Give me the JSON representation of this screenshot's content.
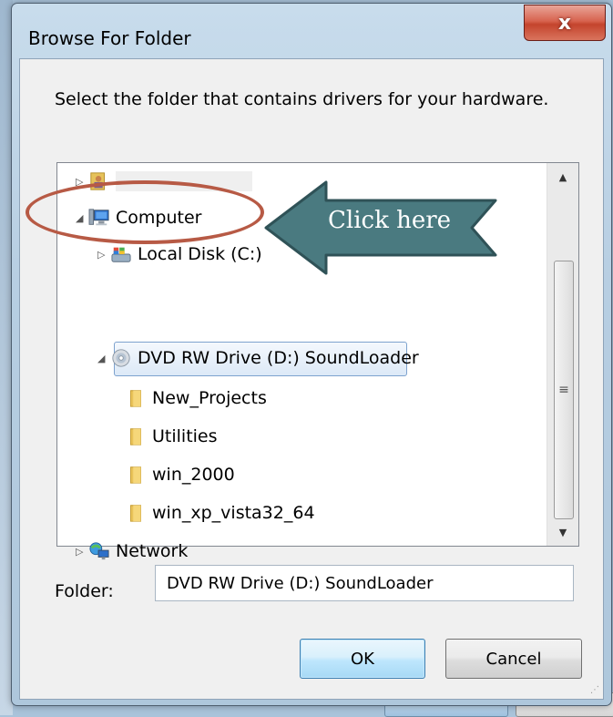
{
  "dialog": {
    "title": "Browse For Folder",
    "close_glyph": "x",
    "instruction": "Select the folder that contains drivers for your hardware.",
    "folder_label": "Folder:",
    "folder_value": "DVD RW Drive (D:) SoundLoader",
    "ok_label": "OK",
    "cancel_label": "Cancel"
  },
  "tree": {
    "items": [
      {
        "label": "",
        "icon": "user-folder-icon",
        "expander": "collapsed"
      },
      {
        "label": "Computer",
        "icon": "computer-icon",
        "expander": "expanded"
      },
      {
        "label": "Local Disk (C:)",
        "icon": "drive-icon",
        "expander": "collapsed"
      },
      {
        "label": "DVD RW Drive (D:) SoundLoader",
        "icon": "dvd-icon",
        "expander": "expanded",
        "selected": true
      },
      {
        "label": "New_Projects",
        "icon": "folder-icon"
      },
      {
        "label": "Utilities",
        "icon": "folder-icon"
      },
      {
        "label": "win_2000",
        "icon": "folder-icon"
      },
      {
        "label": "win_xp_vista32_64",
        "icon": "folder-icon"
      },
      {
        "label": "Network",
        "icon": "network-icon",
        "expander": "collapsed"
      }
    ]
  },
  "annotation": {
    "callout_text": "Click here",
    "ring_color": "#b75a45",
    "arrow_color": "#4a7a80"
  },
  "colors": {
    "selection_border": "#7da2ce",
    "ok_button": "#bee6fd",
    "close_button": "#c4442d"
  }
}
